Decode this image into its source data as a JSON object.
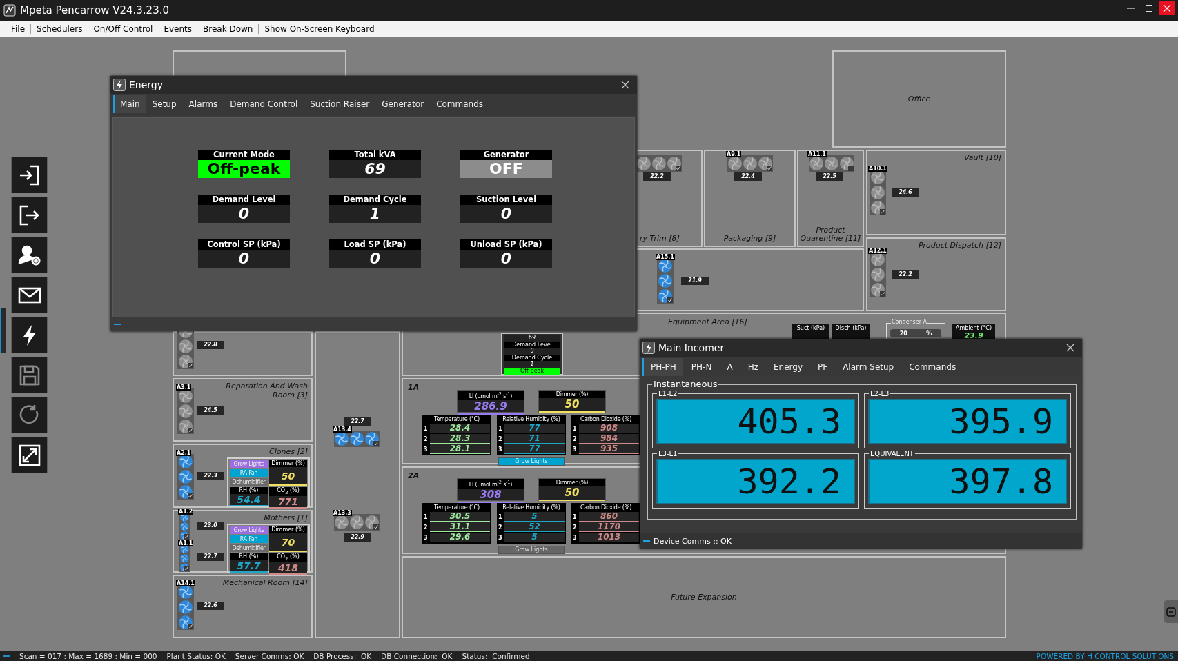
{
  "window": {
    "title": "Mpeta Pencarrow V24.3.23.0"
  },
  "menu": [
    {
      "label": "File",
      "divider_after": true
    },
    {
      "label": "Schedulers",
      "divider_after": false
    },
    {
      "label": "On/Off Control",
      "divider_after": false
    },
    {
      "label": "Events",
      "divider_after": false
    },
    {
      "label": "Break Down",
      "divider_after": true
    },
    {
      "label": "Show On-Screen Keyboard",
      "divider_after": false
    }
  ],
  "toolbar": [
    {
      "disabled": false
    },
    {
      "disabled": false
    },
    {
      "disabled": false
    },
    {
      "disabled": false
    },
    {
      "disabled": false
    },
    {
      "disabled": true
    },
    {
      "disabled": true
    },
    {
      "disabled": false
    }
  ],
  "floor_plan": {
    "rooms": [
      {
        "name": "Office"
      },
      {
        "name": "ry Trim [8]",
        "fans": [
          {
            "running": false,
            "checked": true,
            "temperature": "22.2"
          }
        ]
      },
      {
        "name": "Packaging [9]",
        "fans": [
          {
            "id": "A9.1",
            "running": false,
            "checked": true,
            "temperature": "22.4"
          }
        ]
      },
      {
        "name": "Product Quarentine [11]",
        "fans": [
          {
            "id": "A11.1",
            "running": false,
            "checked": false,
            "temperature": "22.5"
          }
        ]
      },
      {
        "name": "Vault [10]",
        "fans": [
          {
            "id": "A10.1",
            "running": false,
            "checked": true,
            "temperature": "24.6"
          }
        ]
      },
      {
        "name": "Product Dispatch [12]",
        "fans": [
          {
            "id": "A12.1",
            "running": false,
            "checked": true,
            "temperature": "22.2"
          }
        ]
      },
      {
        "fans": [
          {
            "id": "A15.1",
            "running": true,
            "checked": true,
            "temperature": "21.9"
          }
        ]
      },
      {
        "fans": [
          {
            "running": false,
            "checked": true,
            "temperature": "22.8"
          }
        ]
      },
      {
        "name": "Equipment Area [16]",
        "summary": {
          "total": "69",
          "items": [
            {
              "label": "Demand Level",
              "value": "0"
            },
            {
              "label": "Demand Cycle",
              "value": "1"
            }
          ],
          "mode": "Off-peak"
        },
        "gauges": [
          {
            "label": "Suct (kPa)"
          },
          {
            "label": "Disch (kPa)"
          },
          {
            "label": "Ambient (°C)",
            "value": "23.9"
          }
        ],
        "condenser": {
          "label": "Condenser A",
          "value": "20",
          "unit": "%"
        }
      },
      {
        "name": "Reparation And Wash Room [3]",
        "fans": [
          {
            "id": "A3.1",
            "running": false,
            "checked": true,
            "temperature": "24.5"
          }
        ]
      },
      {
        "name": "Clones [2]",
        "fans": [
          {
            "id": "A2.1",
            "running": true,
            "checked": true,
            "temperature": "22.3"
          }
        ],
        "controls": {
          "buttons": [
            {
              "label": "Grow Lights",
              "on": true,
              "color": "#9b6fe0"
            },
            {
              "label": "RA Fan",
              "on": true,
              "color": "#00a3d0"
            },
            {
              "label": "Dehumidifier",
              "on": false
            }
          ],
          "tiles": [
            {
              "label": "Dimmer (%)",
              "value": "50",
              "color": "#f0e060"
            },
            {
              "label": "RH (%)",
              "value": "54.4",
              "color": "#1ca7c9"
            },
            {
              "label": "CO$_{2}$ (%)",
              "value": "771",
              "color": "#d08a8a"
            }
          ]
        }
      },
      {
        "name": "Mothers [1]",
        "fans": [
          {
            "id": "A1.2",
            "running": true,
            "checked": true,
            "temperature": "23.0"
          },
          {
            "id": "A1.1",
            "running": true,
            "checked": true,
            "temperature": "22.7"
          }
        ],
        "controls": {
          "buttons": [
            {
              "label": "Grow Lights",
              "on": true,
              "color": "#9b6fe0"
            },
            {
              "label": "RA Fan",
              "on": true,
              "color": "#00a3d0"
            },
            {
              "label": "Dehumidifier",
              "on": false
            }
          ],
          "tiles": [
            {
              "label": "Dimmer (%)",
              "value": "70",
              "color": "#f0e060"
            },
            {
              "label": "RH (%)",
              "value": "57.7",
              "color": "#1ca7c9"
            },
            {
              "label": "CO$_{2}$ (%)",
              "value": "418",
              "color": "#d08a8a"
            }
          ]
        }
      },
      {
        "name": "Mechanical Room [14]",
        "fans": [
          {
            "id": "A14.1",
            "running": true,
            "checked": true,
            "temperature": "22.6"
          }
        ]
      },
      {
        "fans": [
          {
            "id": "A13.4",
            "running": true,
            "checked": true,
            "temperature": "22.7"
          },
          {
            "id": "A13.3",
            "running": false,
            "checked": true,
            "temperature": "22.9"
          }
        ]
      },
      {
        "name": "1A",
        "zone": {
          "tiles": [
            {
              "label": "LI (µmol m$^{-2}$ s$^{-1}$)",
              "value": "286.9",
              "color": "#9a7cf2"
            },
            {
              "label": "Dimmer (%)",
              "value": "50",
              "color": "#f0e060"
            }
          ],
          "tables": [
            {
              "label": "Temperature (°C)",
              "color": "#9ee89e",
              "rows": [
                {
                  "index": "1",
                  "value": "28.4"
                },
                {
                  "index": "2",
                  "value": "28.3"
                },
                {
                  "index": "3",
                  "value": "28.1"
                }
              ]
            },
            {
              "label": "Relative Humidity (%)",
              "color": "#1ca7c9",
              "rows": [
                {
                  "index": "1",
                  "value": "77"
                },
                {
                  "index": "2",
                  "value": "71"
                },
                {
                  "index": "3",
                  "value": "77"
                }
              ]
            },
            {
              "label": "Carbon Dioxide (%)",
              "color": "#d08a8a",
              "rows": [
                {
                  "index": "1",
                  "value": "908"
                },
                {
                  "index": "2",
                  "value": "984"
                },
                {
                  "index": "3",
                  "value": "935"
                }
              ]
            }
          ],
          "button": {
            "label": "Grow Lights",
            "on": true
          }
        }
      },
      {
        "name": "2A",
        "zone": {
          "tiles": [
            {
              "label": "LI (µmol m$^{-2}$ s$^{-1}$)",
              "value": "308",
              "color": "#9a7cf2"
            },
            {
              "label": "Dimmer (%)",
              "value": "50",
              "color": "#f0e060"
            }
          ],
          "tables": [
            {
              "label": "Temperature (°C)",
              "color": "#9ee89e",
              "rows": [
                {
                  "index": "1",
                  "value": "30.5"
                },
                {
                  "index": "2",
                  "value": "31.1"
                },
                {
                  "index": "3",
                  "value": "29.6"
                }
              ]
            },
            {
              "label": "Relative Humidity (%)",
              "color": "#1ca7c9",
              "rows": [
                {
                  "index": "1",
                  "value": "5"
                },
                {
                  "index": "2",
                  "value": "52"
                },
                {
                  "index": "3",
                  "value": "5"
                }
              ]
            },
            {
              "label": "Carbon Dioxide (%)",
              "color": "#d08a8a",
              "rows": [
                {
                  "index": "1",
                  "value": "860"
                },
                {
                  "index": "2",
                  "value": "1170"
                },
                {
                  "index": "3",
                  "value": "1013"
                }
              ]
            }
          ],
          "button": {
            "label": "Grow Lights",
            "on": false
          }
        }
      },
      {
        "name": "Future Expansion"
      }
    ]
  },
  "energy_window": {
    "title": "Energy",
    "tabs": [
      {
        "label": "Main",
        "selected": true
      },
      {
        "label": "Setup",
        "selected": false
      },
      {
        "label": "Alarms",
        "selected": false
      },
      {
        "label": "Demand Control",
        "selected": false
      },
      {
        "label": "Suction Raiser",
        "selected": false
      },
      {
        "label": "Generator",
        "selected": false
      },
      {
        "label": "Commands",
        "selected": false
      }
    ],
    "tiles": [
      {
        "label": "Current Mode",
        "value": "Off-peak",
        "kind": "mode"
      },
      {
        "label": "Total kVA",
        "value": "69",
        "kind": "value"
      },
      {
        "label": "Generator",
        "value": "OFF",
        "kind": "switch"
      },
      {
        "label": "Demand Level",
        "value": "0",
        "kind": "value"
      },
      {
        "label": "Demand Cycle",
        "value": "1",
        "kind": "value"
      },
      {
        "label": "Suction Level",
        "value": "0",
        "kind": "value"
      },
      {
        "label": "Control SP (kPa)",
        "value": "0",
        "kind": "value"
      },
      {
        "label": "Load SP (kPa)",
        "value": "0",
        "kind": "value"
      },
      {
        "label": "Unload SP (kPa)",
        "value": "0",
        "kind": "value"
      }
    ]
  },
  "incomer_window": {
    "title": "Main Incomer",
    "tabs": [
      {
        "label": "PH-PH",
        "selected": true
      },
      {
        "label": "PH-N",
        "selected": false
      },
      {
        "label": "A",
        "selected": false
      },
      {
        "label": "Hz",
        "selected": false
      },
      {
        "label": "Energy",
        "selected": false
      },
      {
        "label": "PF",
        "selected": false
      },
      {
        "label": "Alarm Setup",
        "selected": false
      },
      {
        "label": "Commands",
        "selected": false
      }
    ],
    "group": "Instantaneous",
    "readings": [
      {
        "label": "L1-L2",
        "value": "405.3"
      },
      {
        "label": "L2-L3",
        "value": "395.9"
      },
      {
        "label": "L3-L1",
        "value": "392.2"
      },
      {
        "label": "EQUIVALENT",
        "value": "397.8"
      }
    ],
    "status": "Device Comms :: OK"
  },
  "status_bar": {
    "items": [
      "Scan = 017 : Max = 1689 : Min = 000",
      "Plant Status: OK",
      "Server Comms: OK",
      "DB Process:  OK",
      "DB Connection:  OK",
      "Status:  Confirmed"
    ],
    "credit": "POWERED BY H CONTROL SOLUTIONS"
  }
}
